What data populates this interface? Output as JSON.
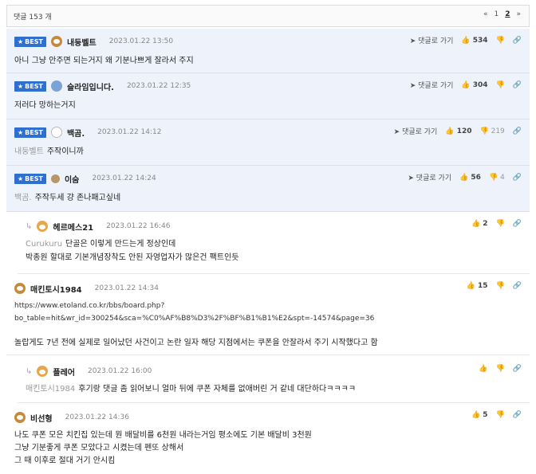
{
  "header": {
    "count": "댓글 153 개",
    "prev": "«",
    "page1": "1",
    "page2": "2",
    "next": "»"
  },
  "icons": {
    "goto": "send-arrow-icon",
    "up": "thumbs-up-icon",
    "down": "thumbs-down-icon",
    "link": "link-icon"
  },
  "comments": [
    {
      "best": "BEST",
      "nick": "내둥벨트",
      "date": "2023.01.22 13:50",
      "goto": "댓글로 가기",
      "up": "534",
      "down": "",
      "text": "아니 그냥 안주면 되는거지 왜 기분나쁘게 잘라서 주지"
    },
    {
      "best": "BEST",
      "nick": "슬라임입니다.",
      "date": "2023.01.22 12:35",
      "goto": "댓글로 가기",
      "up": "304",
      "down": "",
      "text": "저러다 망하는거지"
    },
    {
      "best": "BEST",
      "nick": "백곰.",
      "date": "2023.01.22 14:12",
      "goto": "댓글로 가기",
      "up": "120",
      "down": "219",
      "to": "내둥벨트",
      "text": "주작이니까"
    },
    {
      "best": "BEST",
      "nick": "이숨",
      "date": "2023.01.22 14:24",
      "goto": "댓글로 가기",
      "up": "56",
      "down": "4",
      "to": "백곰.",
      "text": "주작두세 걍 존나패고싶네"
    },
    {
      "nick": "헤르메스21",
      "date": "2023.01.22 16:46",
      "up": "2",
      "down": "",
      "to": "Curukuru",
      "text": "단골은 이렇게 만드는게 정상인데",
      "text2": "박종원 할대로 기본개념장착도 안된 자영업자가 많은건 팩트인듯"
    },
    {
      "nick": "매킨토시1984",
      "date": "2023.01.22 14:34",
      "up": "15",
      "down": "",
      "url1": "https://www.etoland.co.kr/bbs/board.php?",
      "url2": "bo_table=hit&wr_id=300254&sca=%C0%AF%B8%D3%2F%BF%B1%B1%E2&spt=-14574&page=36",
      "text": "놀랍게도 7년 전에 실제로 일어났던 사건이고 논란 일자 해당 지점에서는 쿠폰을 안잘라서 주기 시작했다고 함"
    },
    {
      "nick": "플레어",
      "date": "2023.01.22 16:00",
      "up": "",
      "down": "",
      "to": "매킨토시1984",
      "text": "후기랑 댓글 좀 읽어보니 얼마 뒤에 쿠폰 자체를 없애버린 거 같네 대단하다ㅋㅋㅋㅋ"
    },
    {
      "nick": "비선형",
      "date": "2023.01.22 14:36",
      "up": "5",
      "down": "",
      "text": "나도 쿠폰 모은 치킨집 있는데 뭔 배달비를 6천원 내라는거임 평소에도 기본 배달비 3천원",
      "text2": "그냥 기분좋게 쿠폰 모았다고 시켰는데 펜또 상해서",
      "text3": "그 때 이후로 절대 거기 안시킴"
    }
  ]
}
